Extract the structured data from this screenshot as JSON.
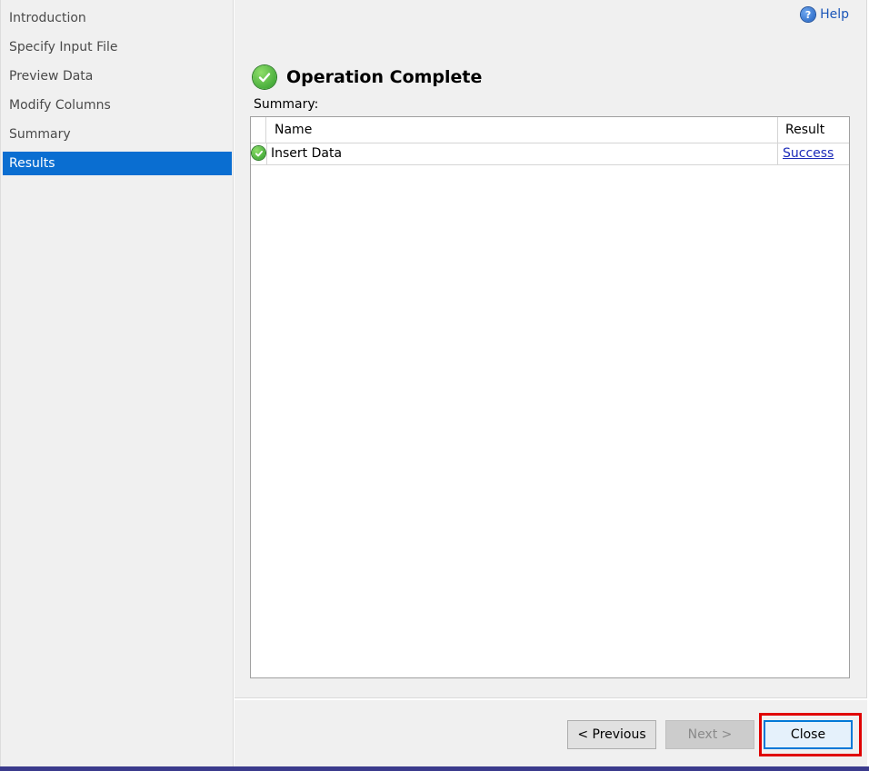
{
  "sidebar": {
    "items": [
      {
        "label": "Introduction",
        "active": false
      },
      {
        "label": "Specify Input File",
        "active": false
      },
      {
        "label": "Preview Data",
        "active": false
      },
      {
        "label": "Modify Columns",
        "active": false
      },
      {
        "label": "Summary",
        "active": false
      },
      {
        "label": "Results",
        "active": true
      }
    ],
    "active_color": "#0a6ed1"
  },
  "header": {
    "help_label": "Help",
    "help_icon": "question-circle-icon"
  },
  "main": {
    "title": "Operation Complete",
    "title_icon": "success-check-icon",
    "summary_label": "Summary:",
    "table": {
      "columns": [
        "Name",
        "Result"
      ],
      "rows": [
        {
          "status_icon": "success-check-icon",
          "name": "Insert Data",
          "result": "Success"
        }
      ]
    }
  },
  "footer": {
    "previous_label": "< Previous",
    "next_label": "Next >",
    "next_enabled": false,
    "close_label": "Close",
    "highlight_color": "#e00000"
  }
}
